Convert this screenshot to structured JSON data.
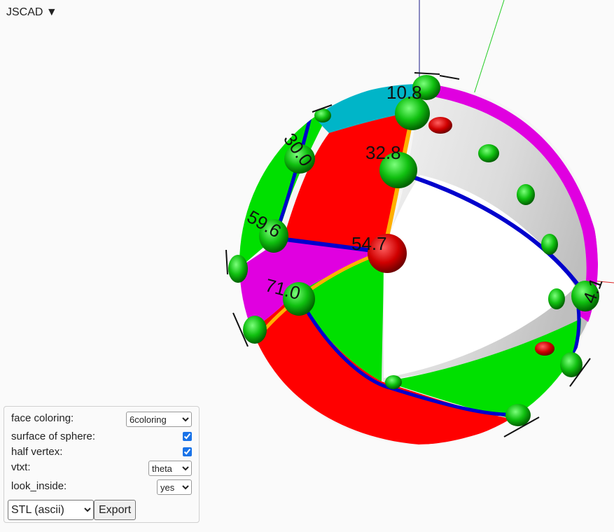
{
  "app": {
    "menu_label": "JSCAD ▼"
  },
  "viewer": {
    "vertex_labels": [
      "10.8",
      "32.8",
      "54.7",
      "30.0",
      "59.6",
      "71.0",
      "4.1"
    ],
    "colors": {
      "background": "#fafafa",
      "red": "#ff0000",
      "green": "#00e000",
      "cyan": "#00b5c8",
      "magenta": "#e000e0",
      "blue_edge": "#0000cc",
      "orange_edge": "#ffb000"
    }
  },
  "params": {
    "face_coloring": {
      "label": "face coloring:",
      "value": "6coloring"
    },
    "surface_of_sphere": {
      "label": "surface of sphere:",
      "checked": true
    },
    "half_vertex": {
      "label": "half vertex:",
      "checked": true
    },
    "vtxt": {
      "label": "vtxt:",
      "value": "theta"
    },
    "look_inside": {
      "label": "look_inside:",
      "value": "yes"
    }
  },
  "export": {
    "format": "STL (ascii)",
    "button_label": "Export"
  }
}
